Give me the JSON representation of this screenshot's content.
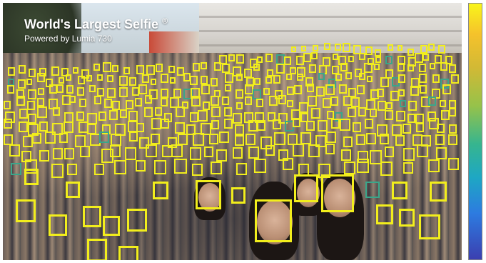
{
  "overlay": {
    "title": "World's Largest Selfie",
    "registered_mark": "®",
    "subtitle": "Powered by Lumia 730"
  },
  "detection": {
    "box_color": "#f2ee1c",
    "low_confidence_color": "#3aa68a"
  },
  "colorbar": {
    "colors": [
      "#f9f51a",
      "#f5c22b",
      "#96c24a",
      "#36b58f",
      "#2d7be0",
      "#3b3fb0"
    ]
  }
}
